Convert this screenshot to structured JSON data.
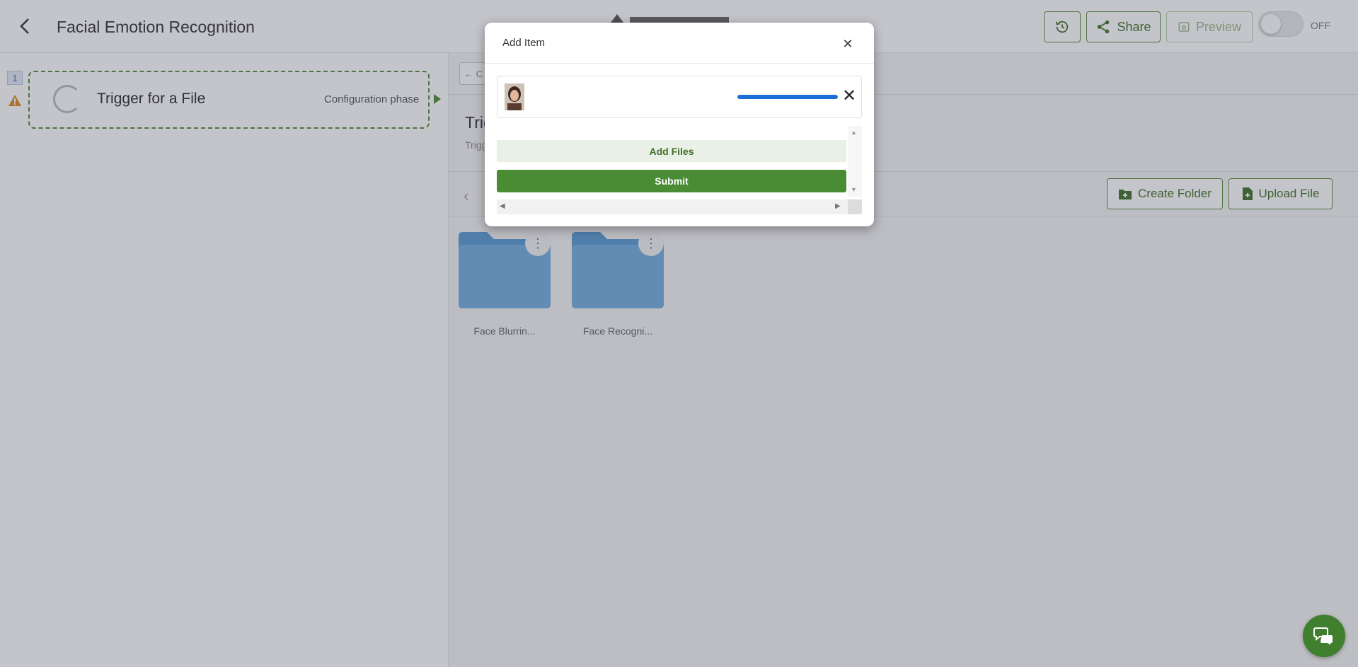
{
  "header": {
    "title": "Facial Emotion Recognition",
    "share_label": "Share",
    "preview_label": "Preview",
    "toggle_state": "OFF"
  },
  "workflow": {
    "step_number": "1",
    "step_title": "Trigger for a File",
    "step_phase": "Configuration phase"
  },
  "panel": {
    "title_partial": "Trig",
    "subtitle_partial": "Trigg",
    "back_partial": "← C",
    "create_folder_label": "Create Folder",
    "upload_file_label": "Upload File",
    "folders": [
      {
        "name": "Face Blurrin..."
      },
      {
        "name": "Face Recogni..."
      }
    ]
  },
  "modal": {
    "title": "Add Item",
    "file_upload_progress": 1.0,
    "add_files_label": "Add Files",
    "submit_label": "Submit"
  },
  "colors": {
    "brand_green": "#4a8c34",
    "progress_blue": "#1a6fd6",
    "warning": "#e08a1e",
    "folder_blue": "#6aa6d8"
  }
}
